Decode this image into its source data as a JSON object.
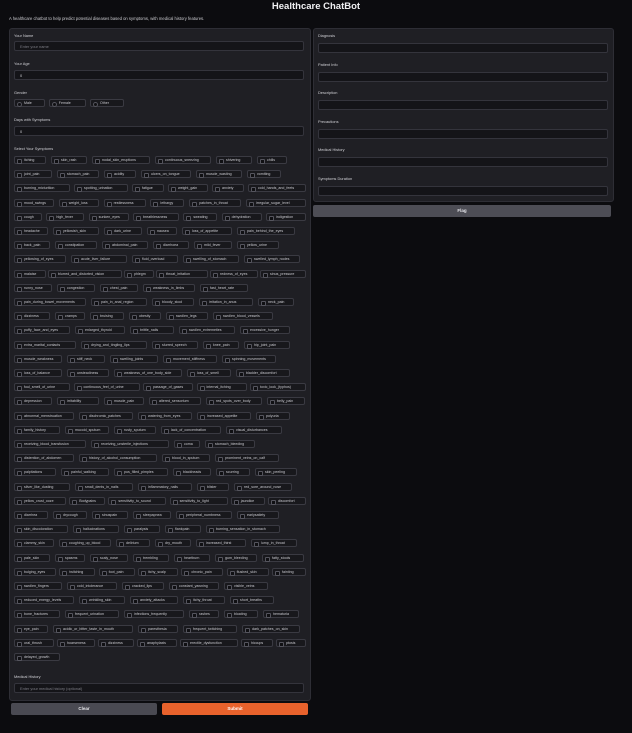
{
  "header": {
    "title": "Healthcare ChatBot",
    "subtitle": "A healthcare chatbot to help predict potential diseases based on symptoms, with medical history features."
  },
  "form": {
    "name_label": "Your Name",
    "name_placeholder": "Enter your name",
    "age_label": "Your Age",
    "age_value": "0",
    "gender_label": "Gender",
    "gender_options": [
      "Male",
      "Female",
      "Other"
    ],
    "days_label": "Days with Symptoms",
    "days_value": "0",
    "symptoms_label": "Select Your Symptoms",
    "symptom_rows": [
      [
        "itching",
        "skin_rash",
        "nodal_skin_eruptions",
        "continuous_sneezing",
        "shivering",
        "chills"
      ],
      [
        "joint_pain",
        "stomach_pain",
        "acidity",
        "ulcers_on_tongue",
        "muscle_wasting",
        "vomiting"
      ],
      [
        "burning_micturition",
        "spotting_urination",
        "fatigue",
        "weight_gain",
        "anxiety",
        "cold_hands_and_feets"
      ],
      [
        "mood_swings",
        "weight_loss",
        "restlessness",
        "lethargy",
        "patches_in_throat",
        "irregular_sugar_level"
      ],
      [
        "cough",
        "high_fever",
        "sunken_eyes",
        "breathlessness",
        "sweating",
        "dehydration",
        "indigestion"
      ],
      [
        "headache",
        "yellowish_skin",
        "dark_urine",
        "nausea",
        "loss_of_appetite",
        "pain_behind_the_eyes"
      ],
      [
        "back_pain",
        "constipation",
        "abdominal_pain",
        "diarrhoea",
        "mild_fever",
        "yellow_urine"
      ],
      [
        "yellowing_of_eyes",
        "acute_liver_failure",
        "fluid_overload",
        "swelling_of_stomach",
        "swelled_lymph_nodes"
      ],
      [
        "malaise",
        "blurred_and_distorted_vision",
        "phlegm",
        "throat_irritation",
        "redness_of_eyes",
        "sinus_pressure"
      ],
      [
        "runny_nose",
        "congestion",
        "chest_pain",
        "weakness_in_limbs",
        "fast_heart_rate"
      ],
      [
        "pain_during_bowel_movements",
        "pain_in_anal_region",
        "bloody_stool",
        "irritation_in_anus",
        "neck_pain"
      ],
      [
        "dizziness",
        "cramps",
        "bruising",
        "obesity",
        "swollen_legs",
        "swollen_blood_vessels"
      ],
      [
        "puffy_face_and_eyes",
        "enlarged_thyroid",
        "brittle_nails",
        "swollen_extremeties",
        "excessive_hunger"
      ],
      [
        "extra_marital_contacts",
        "drying_and_tingling_lips",
        "slurred_speech",
        "knee_pain",
        "hip_joint_pain"
      ],
      [
        "muscle_weakness",
        "stiff_neck",
        "swelling_joints",
        "movement_stiffness",
        "spinning_movements"
      ],
      [
        "loss_of_balance",
        "unsteadiness",
        "weakness_of_one_body_side",
        "loss_of_smell",
        "bladder_discomfort"
      ],
      [
        "foul_smell_of_urine",
        "continuous_feel_of_urine",
        "passage_of_gases",
        "internal_itching",
        "toxic_look_(typhos)"
      ],
      [
        "depression",
        "irritability",
        "muscle_pain",
        "altered_sensorium",
        "red_spots_over_body",
        "belly_pain"
      ],
      [
        "abnormal_menstruation",
        "dischromic_patches",
        "watering_from_eyes",
        "increased_appetite",
        "polyuria"
      ],
      [
        "family_history",
        "mucoid_sputum",
        "rusty_sputum",
        "lack_of_concentration",
        "visual_disturbances"
      ],
      [
        "receiving_blood_transfusion",
        "receiving_unsterile_injections",
        "coma",
        "stomach_bleeding"
      ],
      [
        "distention_of_abdomen",
        "history_of_alcohol_consumption",
        "blood_in_sputum",
        "prominent_veins_on_calf"
      ],
      [
        "palpitations",
        "painful_walking",
        "pus_filled_pimples",
        "blackheads",
        "scurring",
        "skin_peeling"
      ],
      [
        "silver_like_dusting",
        "small_dents_in_nails",
        "inflammatory_nails",
        "blister",
        "red_sore_around_nose"
      ],
      [
        "yellow_crust_ooze",
        "Bodypains",
        "sensitivity_to_sound",
        "sensitivity_to_light",
        "jaundice",
        "discomfort"
      ],
      [
        "diarrhea",
        "drycough",
        "sinuspain",
        "sleepapnea",
        "peripheral_numbness",
        "earlysatiety"
      ],
      [
        "skin_discoloration",
        "hallucinations",
        "paralysis",
        "flankpain",
        "burning_sensation_in_stomach"
      ],
      [
        "clammy_skin",
        "coughing_up_blood",
        "delirium",
        "dry_mouth",
        "increased_thirst",
        "lump_in_throat"
      ],
      [
        "pale_skin",
        "spasms",
        "scaly_nose",
        "trembling",
        "heartburn",
        "gum_bleeding",
        "fatty_stools"
      ],
      [
        "bulging_eyes",
        "twitching",
        "foot_pain",
        "itchy_scalp",
        "chronic_pain",
        "flushed_skin",
        "fainting"
      ],
      [
        "swollen_fingers",
        "cold_intolerance",
        "cracked_lips",
        "constant_yawning",
        "visible_veins"
      ],
      [
        "reduced_energy_levels",
        "wrinkling_skin",
        "anxiety_attacks",
        "itchy_throat",
        "short_breaths"
      ],
      [
        "bone_fractures",
        "frequent_urination",
        "infections_frequently",
        "rashes",
        "bloating",
        "hematuria"
      ],
      [
        "eye_pain",
        "acidic_or_bitter_taste_in_mouth",
        "paresthesia",
        "frequent_twitching",
        "dark_patches_on_skin"
      ],
      [
        "oral_thrush",
        "hoarseness",
        "dizziness",
        "anaphylaxis",
        "erectile_dysfunction",
        "hiccups",
        "ptosis"
      ],
      [
        "delayed_growth"
      ]
    ],
    "history_label": "Medical History",
    "history_placeholder": "Enter your medical history (optional)"
  },
  "output": {
    "fields": [
      "Diagnosis",
      "Patient Info",
      "Description",
      "Precautions",
      "Medical History",
      "Symptoms Duration"
    ]
  },
  "buttons": {
    "flag": "Flag",
    "clear": "Clear",
    "submit": "Submit"
  },
  "colors": {
    "background": "#0c0c0f",
    "panel": "#1f1f24",
    "submit": "#e8622c",
    "secondary_button": "#4a4a52"
  }
}
